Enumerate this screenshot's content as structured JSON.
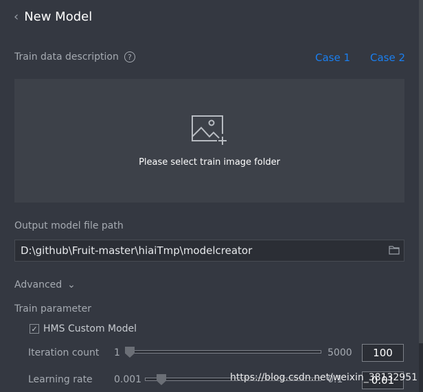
{
  "header": {
    "title": "New Model",
    "back_icon": "chevron-left-icon"
  },
  "train_data": {
    "label": "Train data description",
    "help_icon": "question-circle-icon",
    "links": [
      "Case 1",
      "Case 2"
    ],
    "dropzone_text": "Please select train image folder",
    "dropzone_icon": "image-add-icon"
  },
  "output": {
    "label": "Output model file path",
    "value": "D:\\github\\Fruit-master\\hiaiTmp\\modelcreator",
    "folder_icon": "folder-icon"
  },
  "advanced": {
    "label": "Advanced"
  },
  "train_param": {
    "label": "Train parameter",
    "hms_label": "HMS Custom Model",
    "hms_checked": true,
    "iteration": {
      "label": "Iteration count",
      "min": "1",
      "max": "5000",
      "value": "100"
    },
    "learning": {
      "label": "Learning rate",
      "min": "0.001",
      "max": "0.1",
      "value": "0.01"
    }
  },
  "watermark": "https://blog.csdn.net/weixin_38132951",
  "colors": {
    "accent": "#1a7ff0",
    "background": "#343841"
  }
}
